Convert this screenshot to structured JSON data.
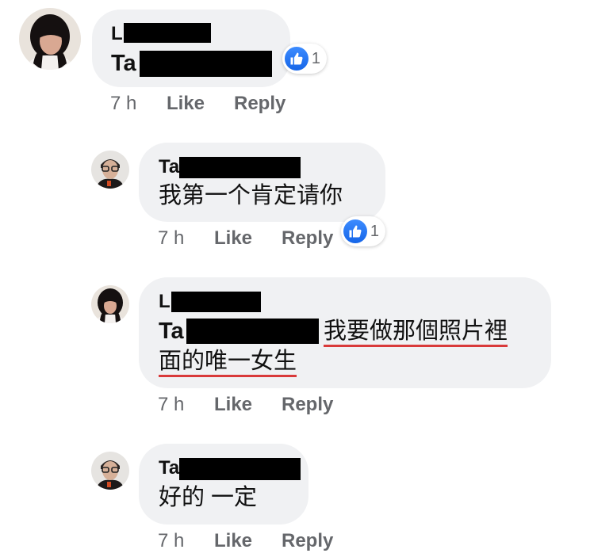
{
  "comments": [
    {
      "author_visible": "L",
      "text_prefix": "Ta",
      "text": "",
      "time": "7 h",
      "like_label": "Like",
      "reply_label": "Reply",
      "reaction_count": "1"
    },
    {
      "author_visible": "Ta",
      "text": "我第一个肯定请你",
      "time": "7 h",
      "like_label": "Like",
      "reply_label": "Reply",
      "reaction_count": "1"
    },
    {
      "author_visible": "L",
      "text_prefix": "Ta",
      "text_line1": "我要做那個照片裡",
      "text_line2": "面的唯一女生",
      "time": "7 h",
      "like_label": "Like",
      "reply_label": "Reply"
    },
    {
      "author_visible": "Ta",
      "text": "好的 一定",
      "time": "7 h",
      "like_label": "Like",
      "reply_label": "Reply"
    }
  ],
  "colors": {
    "bubble": "#f0f1f3",
    "meta_text": "#65676b",
    "like_blue": "#1877f2",
    "redaction": "#000000",
    "underline_red": "#d93a3a"
  },
  "icons": [
    "thumbs-up-icon"
  ]
}
